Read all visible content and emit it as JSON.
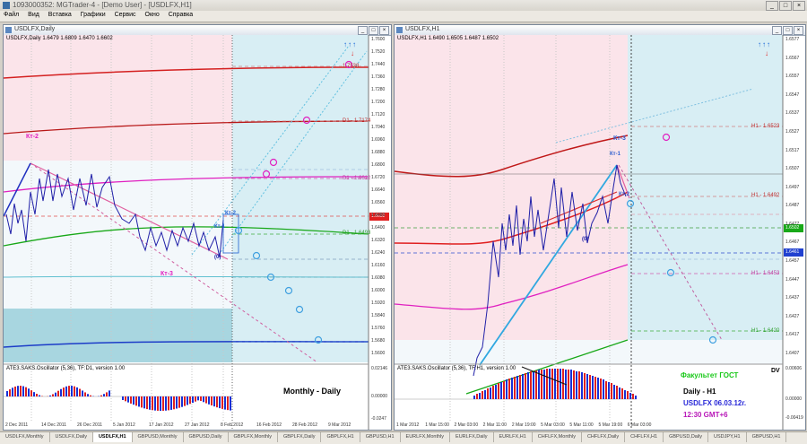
{
  "app": {
    "title": "1093000352: MGTrader-4 - [Demo User] - [USDLFX,H1]",
    "menu": [
      "Файл",
      "Вид",
      "Вставка",
      "Графики",
      "Сервис",
      "Окно",
      "Справка"
    ],
    "window_buttons": [
      "_",
      "□",
      "×"
    ]
  },
  "left_chart": {
    "title": "USDLFX,Daily",
    "ohlc": "USDLFX,Daily 1.6479 1.6809 1.6470 1.6602",
    "label_kt2": "Кт-2",
    "label_kt3": "Кт-3",
    "label_kt1": "Кт-1",
    "label_kt2b": "Кт-2",
    "label_zero": "(0)",
    "indicator_title": "ATE3.SAKS.Oscillator (5,36), TF:D1, version 1.00",
    "caption": "Monthly - Daily",
    "price_ticks": [
      "1.7600",
      "1.7520",
      "1.7440",
      "1.7360",
      "1.7280",
      "1.7200",
      "1.7120",
      "1.7040",
      "1.6960",
      "1.6880",
      "1.6800",
      "1.6720",
      "1.6640",
      "1.6560",
      "1.6480",
      "1.6400",
      "1.6320",
      "1.6240",
      "1.6160",
      "1.6080",
      "1.6000",
      "1.5920",
      "1.5840",
      "1.5760",
      "1.5680",
      "1.5600"
    ],
    "indicator_ticks": [
      "0.02146",
      "0.00000",
      "-0.0247"
    ],
    "time_ticks": [
      "2 Dec 2011",
      "14 Dec 2011",
      "26 Dec 2011",
      "5 Jan 2012",
      "17 Jan 2012",
      "27 Jan 2012",
      "8 Feb 2012",
      "16 Feb 2012",
      "28 Feb 2012",
      "9 Mar 2012"
    ],
    "levels": [
      "1.7538",
      "D1 - 1.7174",
      "D1 - 1.6612",
      "D1 - 1.6493"
    ],
    "current_price": "1.6602"
  },
  "right_chart": {
    "title": "USDLFX,H1",
    "ohlc": "USDLFX,H1 1.6490 1.6505 1.6487 1.6502",
    "label_kt3": "Кт-3",
    "label_kt1": "Кт-1",
    "label_kt2": "Кт-2",
    "label_zero": "(0)",
    "indicator_title": "ATE3.SAKS.Oscillator (5,36), TF:H1, version 1.00",
    "caption_faculty": "Факультет ГОСТ",
    "caption_tf": "Daily - H1",
    "caption_symbol": "USDLFX 06.03.12г.",
    "caption_time": "12:30 GMT+6",
    "caption_dv": "DV",
    "price_ticks": [
      "1.6577",
      "1.6567",
      "1.6557",
      "1.6547",
      "1.6537",
      "1.6527",
      "1.6517",
      "1.6507",
      "1.6497",
      "1.6487",
      "1.6477",
      "1.6467",
      "1.6457",
      "1.6447",
      "1.6437",
      "1.6427",
      "1.6417",
      "1.6407"
    ],
    "indicator_ticks": [
      "0.00606",
      "0.00000",
      "-0.00419"
    ],
    "time_ticks": [
      "1 Mar 2012",
      "1 Mar 15:00",
      "2 Mar 03:00",
      "2 Mar 11:00",
      "2 Mar 19:00",
      "5 Mar 03:00",
      "5 Mar 11:00",
      "5 Mar 19:00",
      "6 Mar 03:00"
    ],
    "levels": [
      "H1 - 1.6523",
      "H1 - 1.6492",
      "H1 - 1.6453",
      "H1 - 1.6420"
    ],
    "current_price": "1.6502",
    "price_markers": [
      "1.6490",
      "1.6461"
    ]
  },
  "tabs": [
    "USDLFX,Monthly",
    "USDLFX,Daily",
    "USDLFX,H1",
    "GBPUSD,Monthly",
    "GBPUSD,Daily",
    "GBPLFX,Monthly",
    "GBPLFX,Daily",
    "GBPLFX,H1",
    "GBPUSD,H1",
    "EURLFX,Monthly",
    "EURLFX,Daily",
    "EURLFX,H1",
    "CHFLFX,Monthly",
    "CHFLFX,Daily",
    "CHFLFX,H1",
    "GBPUSD,Daily",
    "USDJPY,H1",
    "GBPUSD,H1"
  ],
  "active_tab": "USDLFX,H1",
  "colors": {
    "up_arrow": "#1463d6",
    "down_arrow": "#e02020",
    "osc_up": "#1630d8",
    "osc_down": "#e02020",
    "caption_green": "#18c818",
    "caption_blue": "#2828d8",
    "caption_purple": "#b818b8"
  }
}
